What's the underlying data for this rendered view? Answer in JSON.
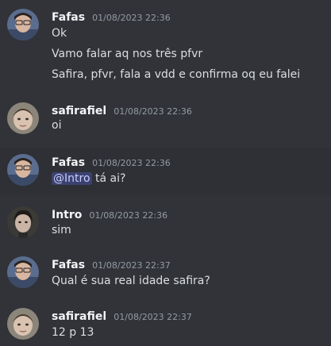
{
  "messages": [
    {
      "author": "Fafas",
      "time": "01/08/2023 22:36",
      "avatar": "fafas-avatar",
      "lines": [
        "Ok",
        "Vamo falar aq nos três pfvr",
        "Safira, pfvr, fala a vdd e confirma oq eu falei"
      ]
    },
    {
      "author": "safirafiel",
      "time": "01/08/2023 22:36",
      "avatar": "safirafiel-avatar",
      "lines": [
        "oi"
      ]
    },
    {
      "author": "Fafas",
      "time": "01/08/2023 22:36",
      "avatar": "fafas-avatar",
      "mention": "@Intro",
      "rest": " tá ai?"
    },
    {
      "author": "Intro",
      "time": "01/08/2023 22:36",
      "avatar": "intro-avatar",
      "lines": [
        "sim"
      ]
    },
    {
      "author": "Fafas",
      "time": "01/08/2023 22:37",
      "avatar": "fafas-avatar",
      "lines": [
        "Qual é sua real idade safira?"
      ]
    },
    {
      "author": "safirafiel",
      "time": "01/08/2023 22:37",
      "avatar": "safirafiel-avatar",
      "lines": [
        "12 p 13"
      ]
    }
  ],
  "colors": {
    "background": "#313338",
    "highlight_row": "#2e3035",
    "mention_bg": "#3c4270",
    "mention_text": "#c9cdfb"
  }
}
